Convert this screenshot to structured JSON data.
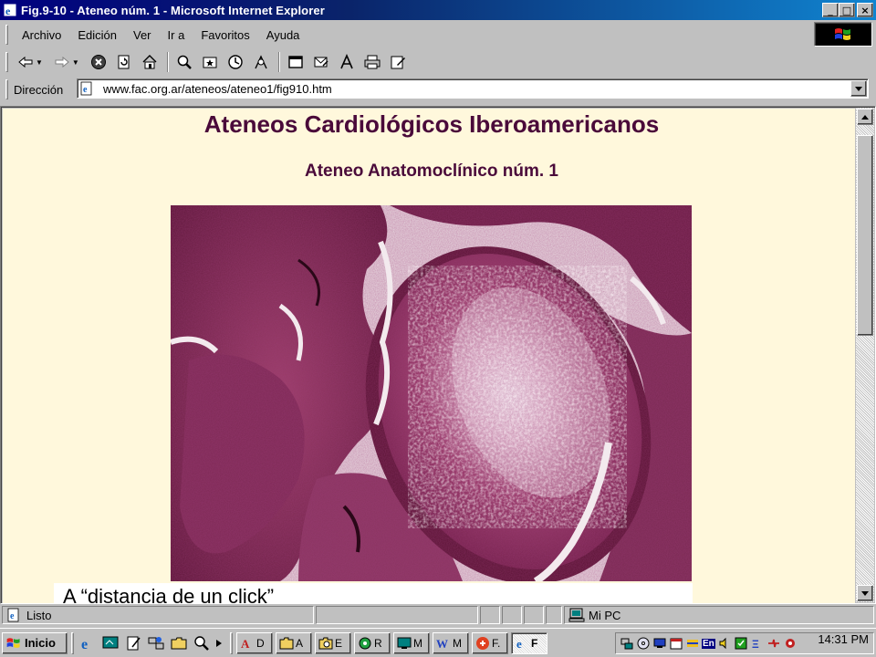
{
  "window": {
    "title": "Fig.9-10 - Ateneo núm. 1 - Microsoft Internet Explorer",
    "minimize": "_",
    "maximize": "□",
    "close": "×"
  },
  "menu": {
    "items": [
      "Archivo",
      "Edición",
      "Ver",
      "Ir a",
      "Favoritos",
      "Ayuda"
    ]
  },
  "toolbar": {
    "buttons": [
      "back-icon",
      "forward-icon",
      "stop-icon",
      "refresh-icon",
      "home-icon",
      "search-icon",
      "favorites-icon",
      "history-icon",
      "channels-icon",
      "fullscreen-icon",
      "mail-icon",
      "font-icon",
      "print-icon",
      "edit-icon"
    ]
  },
  "address": {
    "label": "Dirección",
    "url": "www.fac.org.ar/ateneos/ateneo1/fig910.htm"
  },
  "page": {
    "heading": "Ateneos Cardiológicos Iberoamericanos",
    "subheading": "Ateneo Anatomoclínico núm. 1",
    "caption": "A “distancia de un click”",
    "background": "#fff8dc",
    "heading_color": "#4a0a3a"
  },
  "status": {
    "text": "Listo",
    "zone": "Mi PC"
  },
  "taskbar": {
    "start_label": "Inicio",
    "tasks": [
      {
        "label": "D"
      },
      {
        "label": "A"
      },
      {
        "label": "E"
      },
      {
        "label": "R"
      },
      {
        "label": "M"
      },
      {
        "label": "M"
      },
      {
        "label": "F."
      },
      {
        "label": "F"
      }
    ],
    "lang": "En",
    "clock": "14:31 PM"
  }
}
